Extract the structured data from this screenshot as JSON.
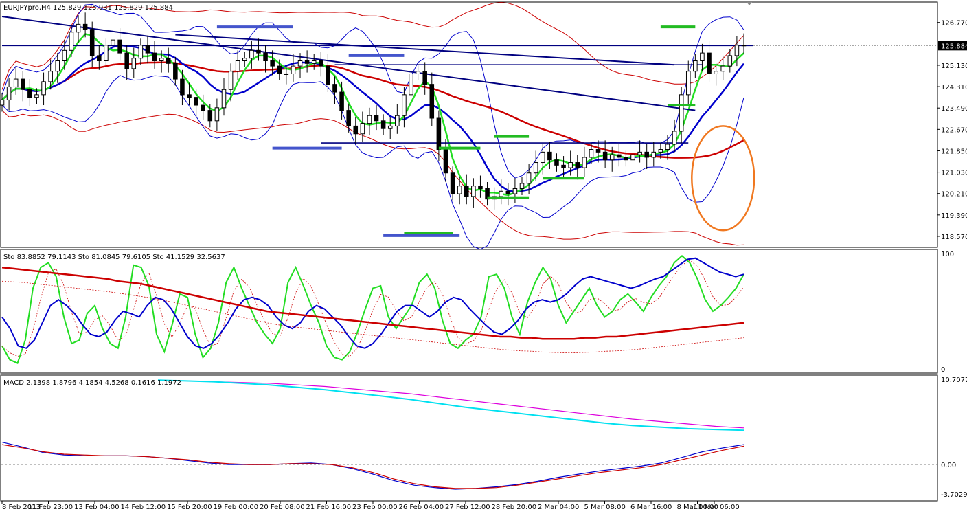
{
  "header": {
    "main_title": "EURJPYpro,H4  125.829 125.931 125.829 125.884",
    "sto_title": "Sto 83.8852 79.1143  Sto 81.0845 79.6105  Sto 41.1529 32.5637",
    "macd_title": "MACD 2.1398 1.8796 4.1854 4.5268 0.1616 1.1972"
  },
  "colors": {
    "background": "#ffffff",
    "candle_up": "#ffffff",
    "candle_down": "#000000",
    "bollinger": "#0000cc",
    "bollinger_slow": "#cc0000",
    "ma_fast": "#22dd22",
    "ma_mid": "#0000cc",
    "ma_slow": "#cc0000",
    "trendline": "#000080",
    "resistance_marker": "#4455cc",
    "support_marker": "#22bb22",
    "macd_cyan": "#00e0f0",
    "macd_magenta": "#dd00dd",
    "circle": "#f07820",
    "current_price_box": "#000000"
  },
  "chart_data": [
    {
      "type": "candlestick",
      "panel": "price",
      "symbol": "EURJPYpro",
      "timeframe": "H4",
      "current_price": "125.884",
      "ylim": [
        118.2,
        127.5
      ],
      "y_ticks": [
        "126.770",
        "125.884",
        "125.130",
        "124.310",
        "123.490",
        "122.670",
        "121.850",
        "121.030",
        "120.210",
        "119.390",
        "118.570"
      ],
      "x_ticks": [
        "8 Feb 2013",
        "11 Feb 23:00",
        "13 Feb 04:00",
        "14 Feb 12:00",
        "15 Feb 20:00",
        "19 Feb 00:00",
        "20 Feb 08:00",
        "21 Feb 16:00",
        "23 Feb 00:00",
        "26 Feb 04:00",
        "27 Feb 12:00",
        "28 Feb 20:00",
        "2 Mar 04:00",
        "5 Mar 08:00",
        "6 Mar 16:00",
        "8 Mar 00:00",
        "11 Mar 06:00"
      ],
      "x_range": [
        0,
        107
      ],
      "close_series": [
        123.8,
        124.3,
        124.6,
        124.2,
        123.9,
        124.0,
        124.5,
        124.9,
        125.3,
        125.7,
        126.4,
        126.7,
        126.5,
        125.5,
        125.3,
        125.9,
        126.1,
        125.6,
        125.0,
        125.4,
        125.9,
        125.6,
        125.3,
        125.4,
        125.2,
        124.6,
        124.0,
        123.9,
        123.6,
        123.4,
        123.0,
        123.5,
        124.2,
        124.9,
        125.3,
        125.4,
        125.7,
        125.6,
        125.3,
        125.1,
        124.8,
        124.8,
        125.1,
        125.3,
        125.2,
        125.3,
        125.1,
        124.4,
        124.1,
        123.4,
        122.8,
        122.5,
        122.9,
        123.2,
        123.0,
        122.7,
        122.8,
        123.2,
        124.0,
        124.8,
        124.9,
        124.4,
        123.1,
        121.9,
        121.0,
        120.2,
        120.5,
        120.1,
        120.5,
        120.4,
        120.0,
        120.1,
        120.3,
        120.2,
        120.4,
        120.6,
        121.0,
        121.4,
        121.8,
        121.5,
        121.3,
        121.2,
        121.4,
        121.2,
        121.6,
        121.9,
        121.8,
        121.5,
        121.7,
        121.6,
        121.5,
        121.7,
        121.8,
        121.6,
        121.8,
        121.9,
        122.1,
        122.6,
        124.0,
        124.9,
        125.3,
        125.6,
        124.8,
        124.9,
        125.1,
        125.5,
        125.9,
        125.884
      ],
      "trendlines": [
        {
          "from": [
            0,
            127.0
          ],
          "to": [
            100,
            123.4
          ]
        },
        {
          "from": [
            25,
            126.3
          ],
          "to": [
            97,
            125.15
          ]
        }
      ],
      "horizontal_lines": [
        125.884,
        125.15,
        122.15
      ],
      "resistance_markers": [
        {
          "from": 31,
          "to": 42,
          "price": 126.6
        },
        {
          "from": 50,
          "to": 58,
          "price": 125.5
        },
        {
          "from": 39,
          "to": 49,
          "price": 121.95
        },
        {
          "from": 55,
          "to": 66,
          "price": 118.6
        }
      ],
      "support_markers": [
        {
          "from": 95,
          "to": 100,
          "price": 126.6
        },
        {
          "from": 96,
          "to": 100,
          "price": 123.6
        },
        {
          "from": 71,
          "to": 76,
          "price": 122.4
        },
        {
          "from": 63,
          "to": 69,
          "price": 121.95
        },
        {
          "from": 78,
          "to": 84,
          "price": 120.8
        },
        {
          "from": 70,
          "to": 76,
          "price": 120.05
        },
        {
          "from": 58,
          "to": 65,
          "price": 118.7
        }
      ],
      "annotation_circle": {
        "center_x": 104,
        "center_price": 120.8,
        "radius_bars": 4.5,
        "radius_price": 2.0
      }
    },
    {
      "type": "line",
      "panel": "stochastic",
      "ylim": [
        0,
        100
      ],
      "y_ticks": [
        "100",
        "0"
      ],
      "series": [
        {
          "name": "Sto 83.8852 79.1143",
          "color": "#22dd22",
          "values": [
            20,
            8,
            5,
            25,
            70,
            88,
            92,
            80,
            45,
            22,
            25,
            48,
            55,
            35,
            22,
            18,
            45,
            90,
            88,
            72,
            30,
            15,
            38,
            65,
            62,
            30,
            10,
            18,
            40,
            75,
            88,
            70,
            55,
            40,
            30,
            22,
            35,
            75,
            88,
            72,
            55,
            40,
            20,
            10,
            8,
            15,
            32,
            52,
            70,
            72,
            45,
            35,
            45,
            55,
            75,
            82,
            70,
            42,
            22,
            18,
            25,
            30,
            45,
            80,
            82,
            70,
            45,
            30,
            58,
            75,
            88,
            78,
            55,
            40,
            50,
            60,
            70,
            55,
            45,
            50,
            60,
            65,
            58,
            50,
            62,
            72,
            80,
            92,
            98,
            92,
            78,
            60,
            50,
            55,
            62,
            70,
            82
          ]
        },
        {
          "name": "Sto 81.0845 79.6105",
          "color": "#0000cc",
          "values": [
            45,
            35,
            20,
            18,
            25,
            40,
            55,
            60,
            55,
            48,
            38,
            30,
            28,
            32,
            42,
            50,
            48,
            45,
            55,
            62,
            60,
            52,
            40,
            28,
            20,
            18,
            22,
            30,
            40,
            52,
            60,
            62,
            60,
            55,
            45,
            38,
            35,
            40,
            50,
            55,
            52,
            45,
            38,
            28,
            20,
            18,
            22,
            30,
            40,
            50,
            55,
            55,
            50,
            45,
            50,
            58,
            62,
            60,
            52,
            45,
            38,
            32,
            30,
            35,
            42,
            52,
            58,
            60,
            58,
            60,
            65,
            72,
            78,
            80,
            78,
            76,
            74,
            72,
            70,
            72,
            75,
            78,
            80,
            85,
            90,
            95,
            96,
            92,
            88,
            84,
            82,
            80,
            82
          ]
        },
        {
          "name": "Sto 41.1529 32.5637",
          "color": "#cc0000",
          "values": [
            88,
            87,
            86,
            85,
            84,
            83,
            82,
            81,
            80,
            79,
            78,
            76,
            75,
            74,
            72,
            70,
            68,
            66,
            64,
            62,
            60,
            58,
            56,
            54,
            52,
            50,
            49,
            48,
            47,
            46,
            45,
            44,
            43,
            42,
            41,
            40,
            39,
            38,
            37,
            36,
            35,
            34,
            33,
            32,
            31,
            30,
            29,
            28,
            28,
            27,
            27,
            26,
            26,
            26,
            26,
            27,
            27,
            28,
            28,
            29,
            30,
            31,
            32,
            33,
            34,
            35,
            36,
            37,
            38,
            39,
            40
          ]
        }
      ]
    },
    {
      "type": "line",
      "panel": "macd",
      "ylim": [
        -3.7029,
        10.7077
      ],
      "y_ticks": [
        "10.7077",
        "0.00",
        "-3.7029"
      ],
      "series": [
        {
          "name": "",
          "color": "#dd00dd",
          "values": [
            10.6,
            10.5,
            10.4,
            10.3,
            10.2,
            10.0,
            9.8,
            9.5,
            9.2,
            8.9,
            8.5,
            8.1,
            7.7,
            7.3,
            6.9,
            6.5,
            6.1,
            5.7,
            5.4,
            5.1,
            4.8,
            4.6
          ]
        },
        {
          "name": "",
          "color": "#00e0f0",
          "values": [
            10.6,
            10.5,
            10.4,
            10.2,
            10.0,
            9.7,
            9.4,
            9.0,
            8.6,
            8.2,
            7.7,
            7.2,
            6.8,
            6.4,
            6.0,
            5.6,
            5.2,
            4.9,
            4.7,
            4.5,
            4.4,
            4.3
          ]
        },
        {
          "name": "",
          "color": "#0000cc",
          "values": [
            2.8,
            2.2,
            1.5,
            1.2,
            1.1,
            1.1,
            1.1,
            1.0,
            0.8,
            0.5,
            0.2,
            0.0,
            0.0,
            0.0,
            0.1,
            0.2,
            0.0,
            -0.5,
            -1.2,
            -2.0,
            -2.6,
            -2.9,
            -3.1,
            -3.0,
            -2.8,
            -2.5,
            -2.1,
            -1.6,
            -1.2,
            -0.8,
            -0.5,
            -0.2,
            0.2,
            0.9,
            1.6,
            2.1,
            2.5
          ]
        },
        {
          "name": "",
          "color": "#cc0000",
          "values": [
            2.5,
            2.1,
            1.6,
            1.3,
            1.2,
            1.1,
            1.1,
            1.0,
            0.8,
            0.6,
            0.3,
            0.1,
            0.0,
            0.0,
            0.1,
            0.1,
            0.0,
            -0.4,
            -1.0,
            -1.8,
            -2.4,
            -2.8,
            -3.0,
            -3.0,
            -2.9,
            -2.6,
            -2.2,
            -1.8,
            -1.4,
            -1.0,
            -0.7,
            -0.4,
            0.0,
            0.6,
            1.2,
            1.8,
            2.3
          ]
        }
      ]
    }
  ]
}
